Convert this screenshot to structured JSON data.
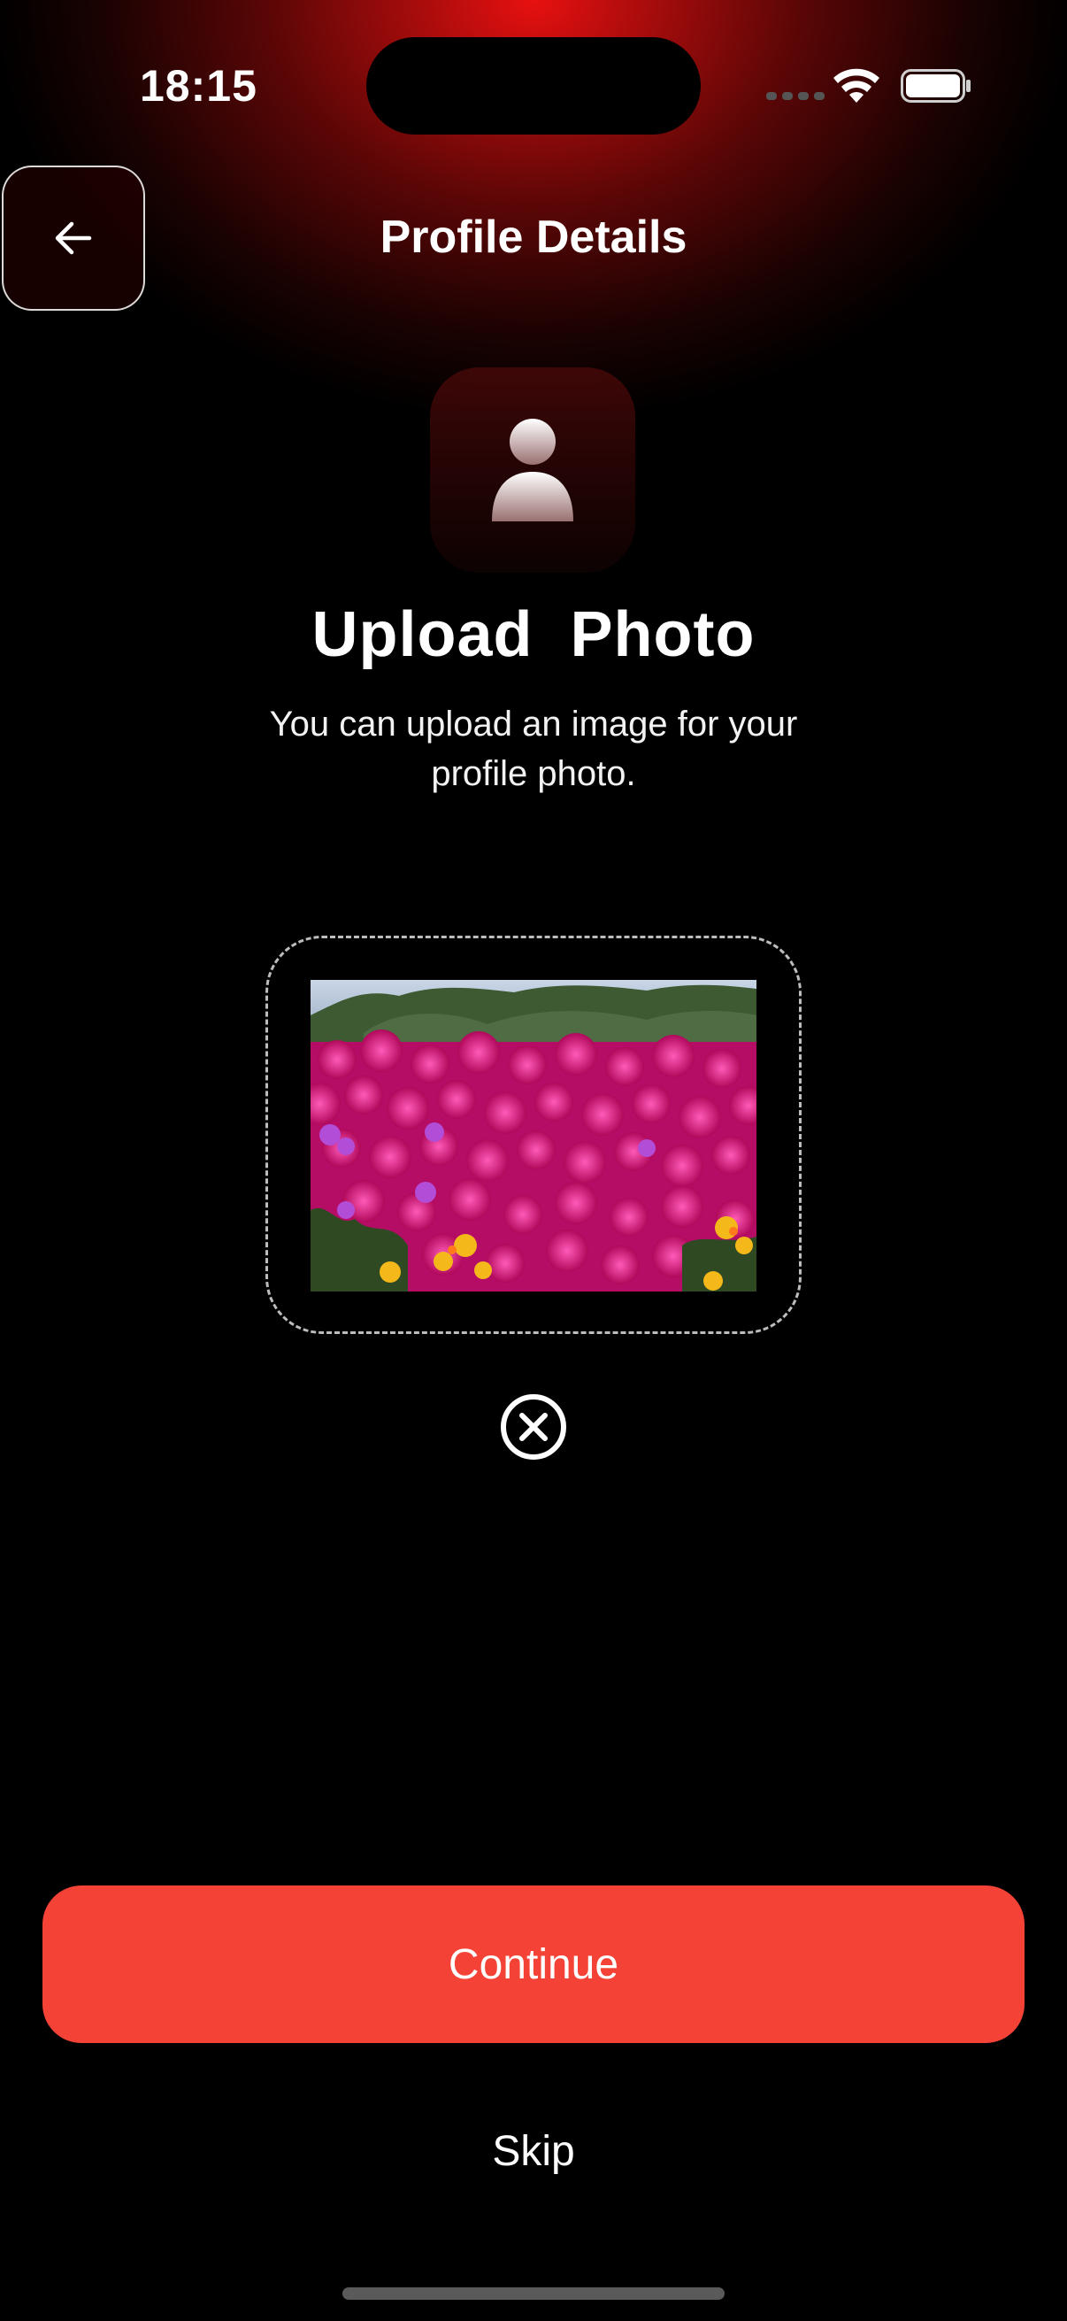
{
  "status_bar": {
    "time": "18:15"
  },
  "header": {
    "title": "Profile Details",
    "back_icon": "arrow-left-icon"
  },
  "avatar": {
    "icon": "person-icon"
  },
  "upload": {
    "headline": "Upload  Photo",
    "description": "You can upload an image for your profile photo.",
    "remove_icon": "close-circle-icon"
  },
  "actions": {
    "continue_label": "Continue",
    "skip_label": "Skip"
  },
  "colors": {
    "accent": "#f44336",
    "background": "#000000",
    "glow": "#e81010"
  }
}
